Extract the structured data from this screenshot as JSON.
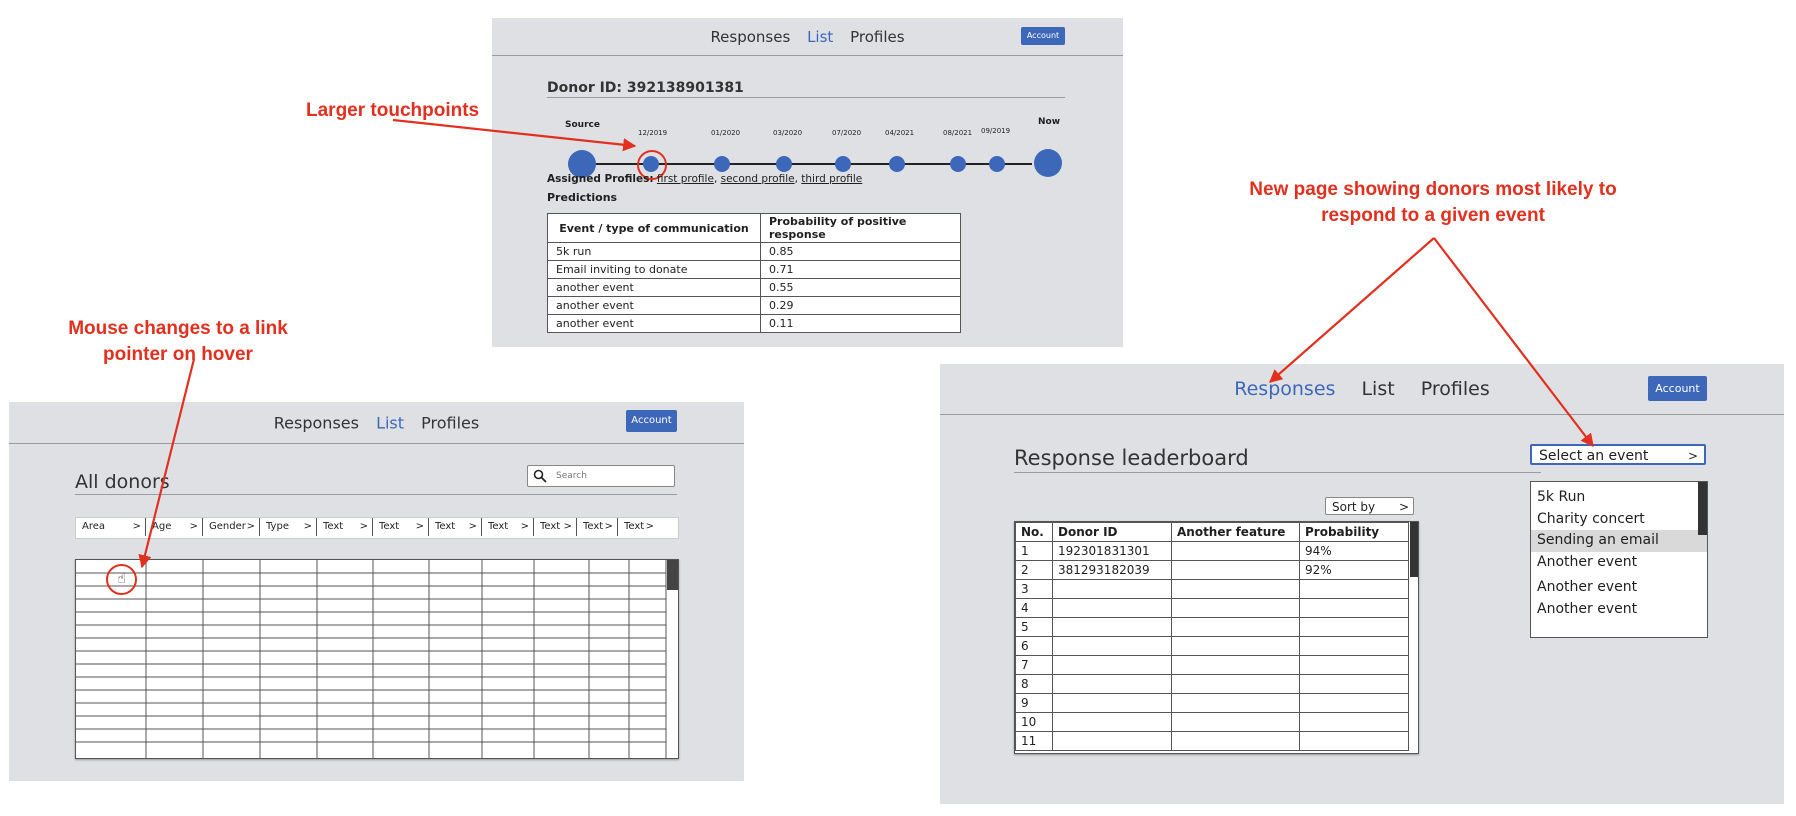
{
  "nav": {
    "responses": "Responses",
    "list": "List",
    "profiles": "Profiles",
    "account": "Account"
  },
  "annotations": {
    "touchpoints": "Larger touchpoints",
    "hover_line1": "Mouse changes to a link",
    "hover_line2": "pointer on hover",
    "newpage_line1": "New page showing donors most likely to",
    "newpage_line2": "respond to a given event"
  },
  "donor_page": {
    "title": "Donor ID: 392138901381",
    "timeline": {
      "source": "Source",
      "now": "Now",
      "dates": [
        "12/2019",
        "01/2020",
        "03/2020",
        "07/2020",
        "04/2021",
        "08/2021",
        "09/2019"
      ]
    },
    "assigned_label": "Assigned Profiles:",
    "profiles": [
      "first profile",
      "second profile",
      "third profile"
    ],
    "predictions_label": "Predictions",
    "table": {
      "headers": [
        "Event / type of communication",
        "Probability of positive response"
      ],
      "rows": [
        [
          "5k run",
          "0.85"
        ],
        [
          "Email inviting to donate",
          "0.71"
        ],
        [
          "another event",
          "0.55"
        ],
        [
          "another event",
          "0.29"
        ],
        [
          "another event",
          "0.11"
        ]
      ]
    }
  },
  "list_page": {
    "title": "All donors",
    "search_placeholder": "Search",
    "columns": [
      "Area",
      "Age",
      "Gender",
      "Type",
      "Text",
      "Text",
      "Text",
      "Text",
      "Text",
      "Text",
      "Text"
    ]
  },
  "responses_page": {
    "title": "Response leaderboard",
    "sort_by": "Sort by",
    "select_event": "Select an event",
    "headers": [
      "No.",
      "Donor ID",
      "Another feature",
      "Probability"
    ],
    "rows": [
      [
        "1",
        "192301831301",
        "",
        "94%"
      ],
      [
        "2",
        "381293182039",
        "",
        "92%"
      ],
      [
        "3",
        "",
        "",
        ""
      ],
      [
        "4",
        "",
        "",
        ""
      ],
      [
        "5",
        "",
        "",
        ""
      ],
      [
        "6",
        "",
        "",
        ""
      ],
      [
        "7",
        "",
        "",
        ""
      ],
      [
        "8",
        "",
        "",
        ""
      ],
      [
        "9",
        "",
        "",
        ""
      ],
      [
        "10",
        "",
        "",
        ""
      ],
      [
        "11",
        "",
        "",
        ""
      ]
    ],
    "events": [
      "5k Run",
      "Charity concert",
      "Sending an email",
      "Another event",
      "Another event",
      "Another event"
    ],
    "selected_event_index": 2
  },
  "colors": {
    "accent": "#3d67b8",
    "annotation": "#e2301f",
    "panel": "#dfe0e4"
  }
}
